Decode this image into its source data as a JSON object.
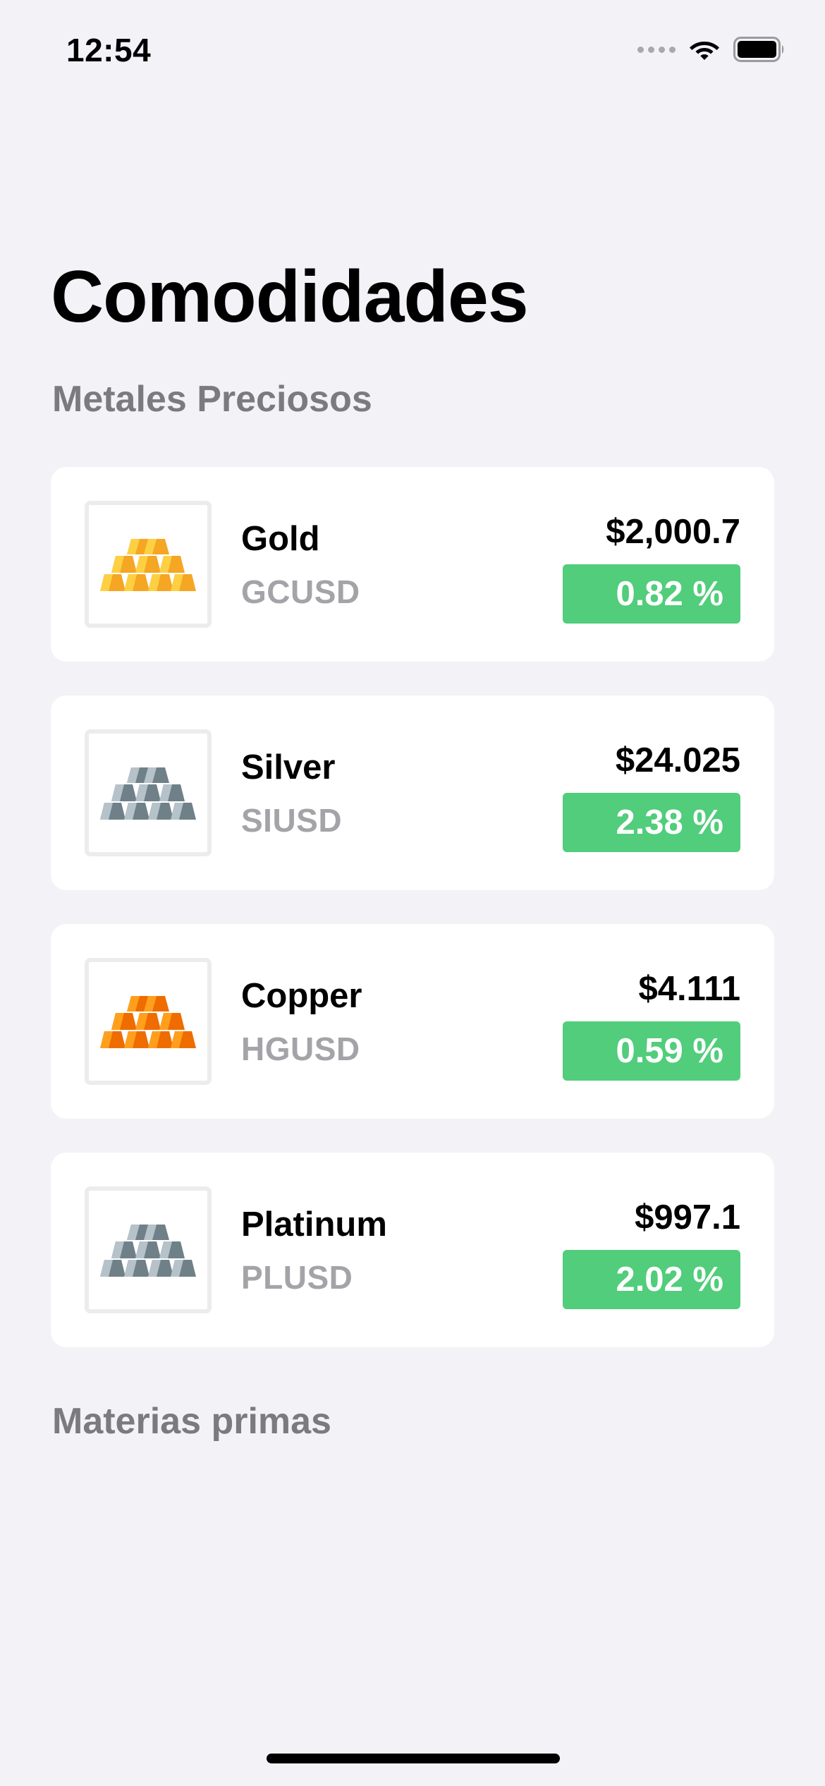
{
  "status_bar": {
    "time": "12:54",
    "icons": [
      "signal-icon",
      "wifi-icon",
      "battery-icon"
    ]
  },
  "page": {
    "title": "Comodidades"
  },
  "sections": {
    "metales": "Metales Preciosos",
    "materias": "Materias primas"
  },
  "colors": {
    "background": "#f2f2f7",
    "card": "#ffffff",
    "positive": "#51cd7b",
    "secondary_text": "#a3a3a8",
    "section_header": "#7a7a7f",
    "gold_light": "#fdd043",
    "gold_dark": "#f5a623",
    "silver_light": "#b6c2c9",
    "silver_dark": "#6f8089",
    "copper_light": "#ff9f1c",
    "copper_dark": "#ef6c00"
  },
  "commodities": [
    {
      "name": "Gold",
      "ticker": "GCUSD",
      "price": "$2,000.7",
      "change": "0.82 %",
      "icon": "gold-bars-icon"
    },
    {
      "name": "Silver",
      "ticker": "SIUSD",
      "price": "$24.025",
      "change": "2.38 %",
      "icon": "silver-bars-icon"
    },
    {
      "name": "Copper",
      "ticker": "HGUSD",
      "price": "$4.111",
      "change": "0.59 %",
      "icon": "copper-bars-icon"
    },
    {
      "name": "Platinum",
      "ticker": "PLUSD",
      "price": "$997.1",
      "change": "2.02 %",
      "icon": "platinum-bars-icon"
    }
  ]
}
